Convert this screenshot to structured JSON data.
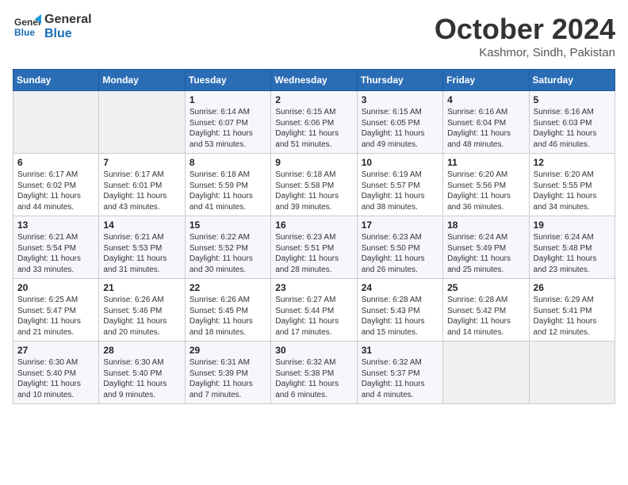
{
  "header": {
    "logo_line1": "General",
    "logo_line2": "Blue",
    "month": "October 2024",
    "location": "Kashmor, Sindh, Pakistan"
  },
  "weekdays": [
    "Sunday",
    "Monday",
    "Tuesday",
    "Wednesday",
    "Thursday",
    "Friday",
    "Saturday"
  ],
  "weeks": [
    [
      {
        "day": "",
        "text": ""
      },
      {
        "day": "",
        "text": ""
      },
      {
        "day": "1",
        "text": "Sunrise: 6:14 AM\nSunset: 6:07 PM\nDaylight: 11 hours and 53 minutes."
      },
      {
        "day": "2",
        "text": "Sunrise: 6:15 AM\nSunset: 6:06 PM\nDaylight: 11 hours and 51 minutes."
      },
      {
        "day": "3",
        "text": "Sunrise: 6:15 AM\nSunset: 6:05 PM\nDaylight: 11 hours and 49 minutes."
      },
      {
        "day": "4",
        "text": "Sunrise: 6:16 AM\nSunset: 6:04 PM\nDaylight: 11 hours and 48 minutes."
      },
      {
        "day": "5",
        "text": "Sunrise: 6:16 AM\nSunset: 6:03 PM\nDaylight: 11 hours and 46 minutes."
      }
    ],
    [
      {
        "day": "6",
        "text": "Sunrise: 6:17 AM\nSunset: 6:02 PM\nDaylight: 11 hours and 44 minutes."
      },
      {
        "day": "7",
        "text": "Sunrise: 6:17 AM\nSunset: 6:01 PM\nDaylight: 11 hours and 43 minutes."
      },
      {
        "day": "8",
        "text": "Sunrise: 6:18 AM\nSunset: 5:59 PM\nDaylight: 11 hours and 41 minutes."
      },
      {
        "day": "9",
        "text": "Sunrise: 6:18 AM\nSunset: 5:58 PM\nDaylight: 11 hours and 39 minutes."
      },
      {
        "day": "10",
        "text": "Sunrise: 6:19 AM\nSunset: 5:57 PM\nDaylight: 11 hours and 38 minutes."
      },
      {
        "day": "11",
        "text": "Sunrise: 6:20 AM\nSunset: 5:56 PM\nDaylight: 11 hours and 36 minutes."
      },
      {
        "day": "12",
        "text": "Sunrise: 6:20 AM\nSunset: 5:55 PM\nDaylight: 11 hours and 34 minutes."
      }
    ],
    [
      {
        "day": "13",
        "text": "Sunrise: 6:21 AM\nSunset: 5:54 PM\nDaylight: 11 hours and 33 minutes."
      },
      {
        "day": "14",
        "text": "Sunrise: 6:21 AM\nSunset: 5:53 PM\nDaylight: 11 hours and 31 minutes."
      },
      {
        "day": "15",
        "text": "Sunrise: 6:22 AM\nSunset: 5:52 PM\nDaylight: 11 hours and 30 minutes."
      },
      {
        "day": "16",
        "text": "Sunrise: 6:23 AM\nSunset: 5:51 PM\nDaylight: 11 hours and 28 minutes."
      },
      {
        "day": "17",
        "text": "Sunrise: 6:23 AM\nSunset: 5:50 PM\nDaylight: 11 hours and 26 minutes."
      },
      {
        "day": "18",
        "text": "Sunrise: 6:24 AM\nSunset: 5:49 PM\nDaylight: 11 hours and 25 minutes."
      },
      {
        "day": "19",
        "text": "Sunrise: 6:24 AM\nSunset: 5:48 PM\nDaylight: 11 hours and 23 minutes."
      }
    ],
    [
      {
        "day": "20",
        "text": "Sunrise: 6:25 AM\nSunset: 5:47 PM\nDaylight: 11 hours and 21 minutes."
      },
      {
        "day": "21",
        "text": "Sunrise: 6:26 AM\nSunset: 5:46 PM\nDaylight: 11 hours and 20 minutes."
      },
      {
        "day": "22",
        "text": "Sunrise: 6:26 AM\nSunset: 5:45 PM\nDaylight: 11 hours and 18 minutes."
      },
      {
        "day": "23",
        "text": "Sunrise: 6:27 AM\nSunset: 5:44 PM\nDaylight: 11 hours and 17 minutes."
      },
      {
        "day": "24",
        "text": "Sunrise: 6:28 AM\nSunset: 5:43 PM\nDaylight: 11 hours and 15 minutes."
      },
      {
        "day": "25",
        "text": "Sunrise: 6:28 AM\nSunset: 5:42 PM\nDaylight: 11 hours and 14 minutes."
      },
      {
        "day": "26",
        "text": "Sunrise: 6:29 AM\nSunset: 5:41 PM\nDaylight: 11 hours and 12 minutes."
      }
    ],
    [
      {
        "day": "27",
        "text": "Sunrise: 6:30 AM\nSunset: 5:40 PM\nDaylight: 11 hours and 10 minutes."
      },
      {
        "day": "28",
        "text": "Sunrise: 6:30 AM\nSunset: 5:40 PM\nDaylight: 11 hours and 9 minutes."
      },
      {
        "day": "29",
        "text": "Sunrise: 6:31 AM\nSunset: 5:39 PM\nDaylight: 11 hours and 7 minutes."
      },
      {
        "day": "30",
        "text": "Sunrise: 6:32 AM\nSunset: 5:38 PM\nDaylight: 11 hours and 6 minutes."
      },
      {
        "day": "31",
        "text": "Sunrise: 6:32 AM\nSunset: 5:37 PM\nDaylight: 11 hours and 4 minutes."
      },
      {
        "day": "",
        "text": ""
      },
      {
        "day": "",
        "text": ""
      }
    ]
  ]
}
